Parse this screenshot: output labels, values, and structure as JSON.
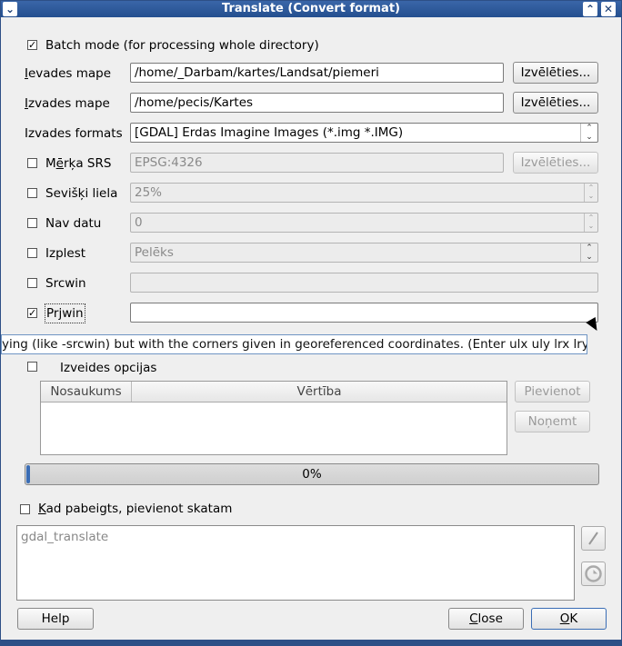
{
  "window": {
    "title": "Translate (Convert format)",
    "menu_icon": "chevron-down-icon",
    "minimize_icon": "chevron-up-icon",
    "close_icon": "close-icon"
  },
  "batch": {
    "label": "Batch mode (for processing whole directory)",
    "checked": true
  },
  "input_dir": {
    "label_first": "I",
    "label_rest": "evades mape",
    "value": "/home/_Darbam/kartes/Landsat/piemeri",
    "button": "Izvēlēties..."
  },
  "output_dir": {
    "label_first": "I",
    "label_rest": "zvades mape",
    "value": "/home/pecis/Kartes",
    "button": "Izvēlēties..."
  },
  "output_format": {
    "label": "Izvades formats",
    "value": "[GDAL] Erdas Imagine Images  (*.img *.IMG)"
  },
  "target_srs": {
    "label_pre": "M",
    "label_u": "ē",
    "label_post": "rķa SRS",
    "value": "EPSG:4326",
    "button": "Izvēlēties...",
    "checked": false
  },
  "outsize": {
    "label": "Sevišķi liela",
    "value": "25%",
    "checked": false
  },
  "nodata": {
    "label": "Nav datu",
    "value": "0",
    "checked": false
  },
  "expand": {
    "label": "Izplest",
    "value": "Pelēks",
    "checked": false
  },
  "srcwin": {
    "label": "Srcwin",
    "value": "",
    "checked": false
  },
  "prjwin": {
    "label": "Prjwin",
    "value": "",
    "checked": true
  },
  "tooltip": "ying (like -srcwin) but with the corners given in georeferenced coordinates. (Enter ulx uly lrx lry)",
  "creation_options": {
    "label": "Izveides opcijas",
    "checked": false,
    "columns": [
      "Nosaukums",
      "Vērtība"
    ],
    "add_button": "Pievienot",
    "remove_button": "Noņemt"
  },
  "progress": {
    "text": "0%",
    "value": 0
  },
  "load_when_done": {
    "label_first": "K",
    "label_rest": "ad pabeigts, pievienot skatam",
    "checked": false
  },
  "command": {
    "text": "gdal_translate"
  },
  "side_buttons": {
    "edit_icon": "pencil-icon",
    "reset_icon": "refresh-icon"
  },
  "footer": {
    "help": "Help",
    "close_first": "C",
    "close_rest": "lose",
    "ok_first": "O",
    "ok_rest": "K"
  }
}
